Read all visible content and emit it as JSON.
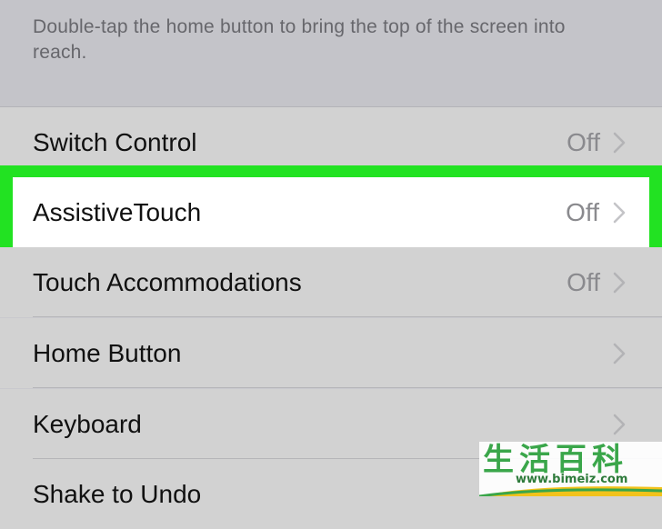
{
  "reachability": {
    "footer_text": "Double-tap the home button to bring the top of the screen into reach."
  },
  "settings_list": {
    "items": [
      {
        "label": "Switch Control",
        "value": "Off"
      },
      {
        "label": "AssistiveTouch",
        "value": "Off",
        "highlighted": true
      },
      {
        "label": "Touch Accommodations",
        "value": "Off"
      },
      {
        "label": "Home Button",
        "value": ""
      },
      {
        "label": "Keyboard",
        "value": ""
      },
      {
        "label": "Shake to Undo",
        "value": ""
      }
    ]
  },
  "watermark": {
    "text": "生活百科",
    "url": "www.bimeiz.com"
  },
  "colors": {
    "highlight": "#22e222",
    "chevron": "#c4c4c7",
    "value_text": "#8a8a8e"
  }
}
